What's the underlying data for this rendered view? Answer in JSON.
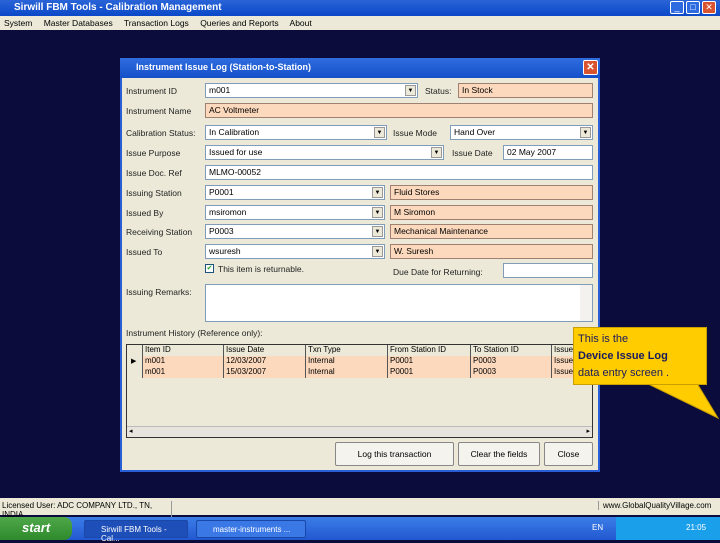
{
  "app": {
    "title": "Sirwill FBM Tools - Calibration Management",
    "menu": [
      "System",
      "Master Databases",
      "Transaction Logs",
      "Queries and Reports",
      "About"
    ]
  },
  "dialog": {
    "title": "Instrument Issue Log (Station-to-Station)",
    "instrument_id": {
      "label": "Instrument ID",
      "value": "m001"
    },
    "status": {
      "label": "Status:",
      "value": "In Stock"
    },
    "instrument_name": {
      "label": "Instrument Name",
      "value": "AC Voltmeter"
    },
    "calibration_status": {
      "label": "Calibration Status:",
      "value": "In Calibration"
    },
    "issue_mode": {
      "label": "Issue Mode",
      "value": "Hand Over"
    },
    "issue_purpose": {
      "label": "Issue Purpose",
      "value": "Issued for use"
    },
    "issue_date": {
      "label": "Issue Date",
      "value": "02 May 2007"
    },
    "issue_doc_ref": {
      "label": "Issue Doc. Ref",
      "value": "MLMO-00052"
    },
    "issuing_station": {
      "label": "Issuing Station",
      "value": "P0001",
      "name": "Fluid Stores"
    },
    "issued_by": {
      "label": "Issued By",
      "value": "msiromon",
      "name": "M Siromon"
    },
    "receiving_station": {
      "label": "Receiving Station",
      "value": "P0003",
      "name": "Mechanical Maintenance"
    },
    "issued_to": {
      "label": "Issued To",
      "value": "wsuresh",
      "name": "W. Suresh"
    },
    "returnable": {
      "label": "This item is returnable."
    },
    "due_date": {
      "label": "Due Date for Returning:",
      "value": ""
    },
    "remarks": {
      "label": "Issuing Remarks:",
      "value": ""
    },
    "history_label": "Instrument History (Reference only):",
    "history": {
      "columns": [
        "Item ID",
        "Issue Date",
        "Txn Type",
        "From Station ID",
        "To Station ID",
        "Issue"
      ],
      "rows": [
        [
          "m001",
          "12/03/2007",
          "Internal",
          "P0001",
          "P0003",
          "Issue"
        ],
        [
          "m001",
          "15/03/2007",
          "Internal",
          "P0001",
          "P0003",
          "Issue"
        ]
      ]
    },
    "buttons": {
      "log": "Log this transaction",
      "clear": "Clear the fields",
      "close": "Close"
    }
  },
  "callout": {
    "line1": "This is the",
    "line2": "Device Issue Log",
    "line3": "data entry screen ."
  },
  "statusbar": {
    "left": "Licensed User: ADC COMPANY LTD., TN, INDIA",
    "right": "www.GlobalQualityVillage.com"
  },
  "taskbar": {
    "start": "start",
    "tasks": [
      "Sirwill FBM Tools - Cal...",
      "master-instruments ..."
    ],
    "lang": "EN",
    "clock": "21:05"
  }
}
